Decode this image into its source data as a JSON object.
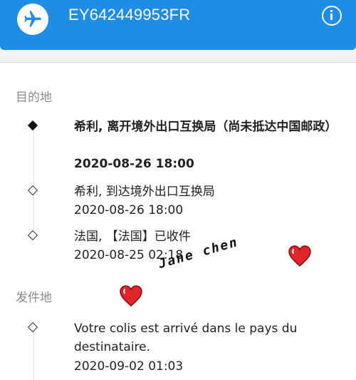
{
  "header": {
    "tracking_number": "EY642449953FR",
    "left_icon": "airplane-icon",
    "right_icon": "info-icon"
  },
  "sections": [
    {
      "label": "目的地",
      "events": [
        {
          "title": "希利, 离开境外出口互换局（尚未抵达中国邮政）",
          "time": "2020-08-26 18:00",
          "current": true
        },
        {
          "title": "希利, 到达境外出口互换局",
          "time": "2020-08-26 18:00",
          "current": false
        },
        {
          "title": "法国, 【法国】已收件",
          "time": "2020-08-25 02:18",
          "current": false
        }
      ]
    },
    {
      "label": "发件地",
      "events": [
        {
          "title": "Votre colis est arrivé dans le pays du destinataire.",
          "time": "2020-09-02 01:03",
          "current": false
        }
      ]
    }
  ],
  "overlay": {
    "signature": "Jane chen",
    "heart_color": "#e0252b"
  },
  "colors": {
    "accent": "#1f8ce6",
    "text": "#222222",
    "muted": "#8a8a8a"
  }
}
